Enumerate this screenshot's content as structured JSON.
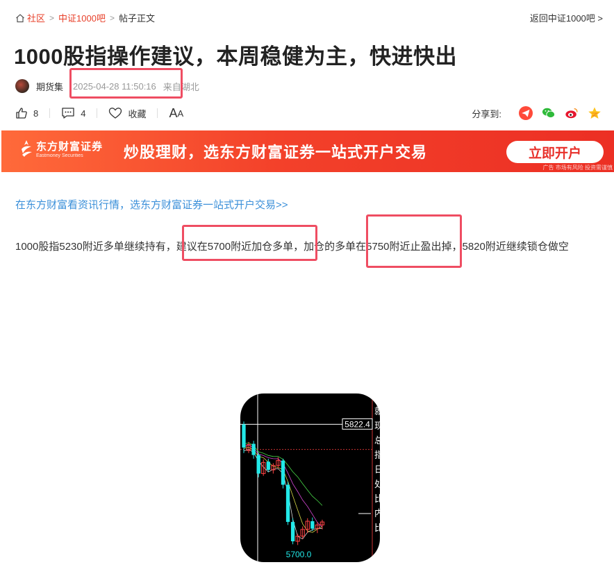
{
  "breadcrumb": {
    "items": [
      "社区",
      "中证1000吧",
      "帖子正文"
    ]
  },
  "back_link": "返回中证1000吧",
  "post": {
    "title": "1000股指操作建议，本周稳健为主，快进快出",
    "author": "期货集",
    "time": "2025-04-28 11:50:16",
    "location": "来自湖北",
    "like_count": "8",
    "comment_count": "4",
    "favorite_label": "收藏",
    "font_toggle_big": "A",
    "font_toggle_small": "A",
    "body_parts": [
      "1000股指5230附近多单继续持有，",
      "建议在5700附近加仓多单",
      "，加仓的多单在5750附近止盈出掉，5820附近继续锁仓做空"
    ]
  },
  "share": {
    "label": "分享到:",
    "icons": [
      "telegram-icon",
      "wechat-icon",
      "weibo-icon",
      "qzone-star-icon"
    ]
  },
  "ad": {
    "brand": "东方财富证券",
    "brand_en": "Eastmoney Securities",
    "slogan": "炒股理财，选东方财富证券一站式开户交易",
    "cta": "立即开户",
    "disclaimer": "广告 市场有风险 投资需谨慎"
  },
  "promo_link": "在东方财富看资讯行情，选东方财富证券一站式开户交易>>",
  "colors": {
    "accent_red": "#e8402a",
    "link_blue": "#3a8fd9",
    "highlight_box": "#ef4d62",
    "candle_up": "#ff4444",
    "candle_down": "#22e8e8"
  },
  "chart_data": {
    "type": "candlestick",
    "price_labels": [
      "5822.4",
      "5700.0"
    ],
    "right_text_glyphs": [
      "就",
      "现",
      "总",
      "指",
      "日",
      "处",
      "比",
      "内",
      "比"
    ],
    "candles": [
      {
        "dir": "down",
        "open": 5822,
        "close": 5760,
        "high": 5830,
        "low": 5745
      },
      {
        "dir": "up",
        "open": 5752,
        "close": 5768,
        "high": 5775,
        "low": 5745
      },
      {
        "dir": "down",
        "open": 5770,
        "close": 5740,
        "high": 5778,
        "low": 5730
      },
      {
        "dir": "down",
        "open": 5740,
        "close": 5690,
        "high": 5746,
        "low": 5680
      },
      {
        "dir": "up",
        "open": 5690,
        "close": 5720,
        "high": 5728,
        "low": 5684
      },
      {
        "dir": "down",
        "open": 5722,
        "close": 5700,
        "high": 5730,
        "low": 5694
      },
      {
        "dir": "up",
        "open": 5700,
        "close": 5712,
        "high": 5718,
        "low": 5690
      },
      {
        "dir": "up",
        "open": 5712,
        "close": 5725,
        "high": 5734,
        "low": 5705
      },
      {
        "dir": "down",
        "open": 5725,
        "close": 5660,
        "high": 5730,
        "low": 5650
      },
      {
        "dir": "down",
        "open": 5660,
        "close": 5560,
        "high": 5668,
        "low": 5552
      },
      {
        "dir": "down",
        "open": 5560,
        "close": 5508,
        "high": 5570,
        "low": 5500
      },
      {
        "dir": "up",
        "open": 5508,
        "close": 5522,
        "high": 5528,
        "low": 5498
      },
      {
        "dir": "up",
        "open": 5522,
        "close": 5540,
        "high": 5548,
        "low": 5514
      },
      {
        "dir": "up",
        "open": 5540,
        "close": 5562,
        "high": 5570,
        "low": 5530
      },
      {
        "dir": "down",
        "open": 5562,
        "close": 5542,
        "high": 5572,
        "low": 5536
      },
      {
        "dir": "up",
        "open": 5542,
        "close": 5552,
        "high": 5560,
        "low": 5530
      },
      {
        "dir": "up",
        "open": 5552,
        "close": 5560,
        "high": 5566,
        "low": 5540
      }
    ],
    "ylim": [
      5480,
      5840
    ]
  }
}
